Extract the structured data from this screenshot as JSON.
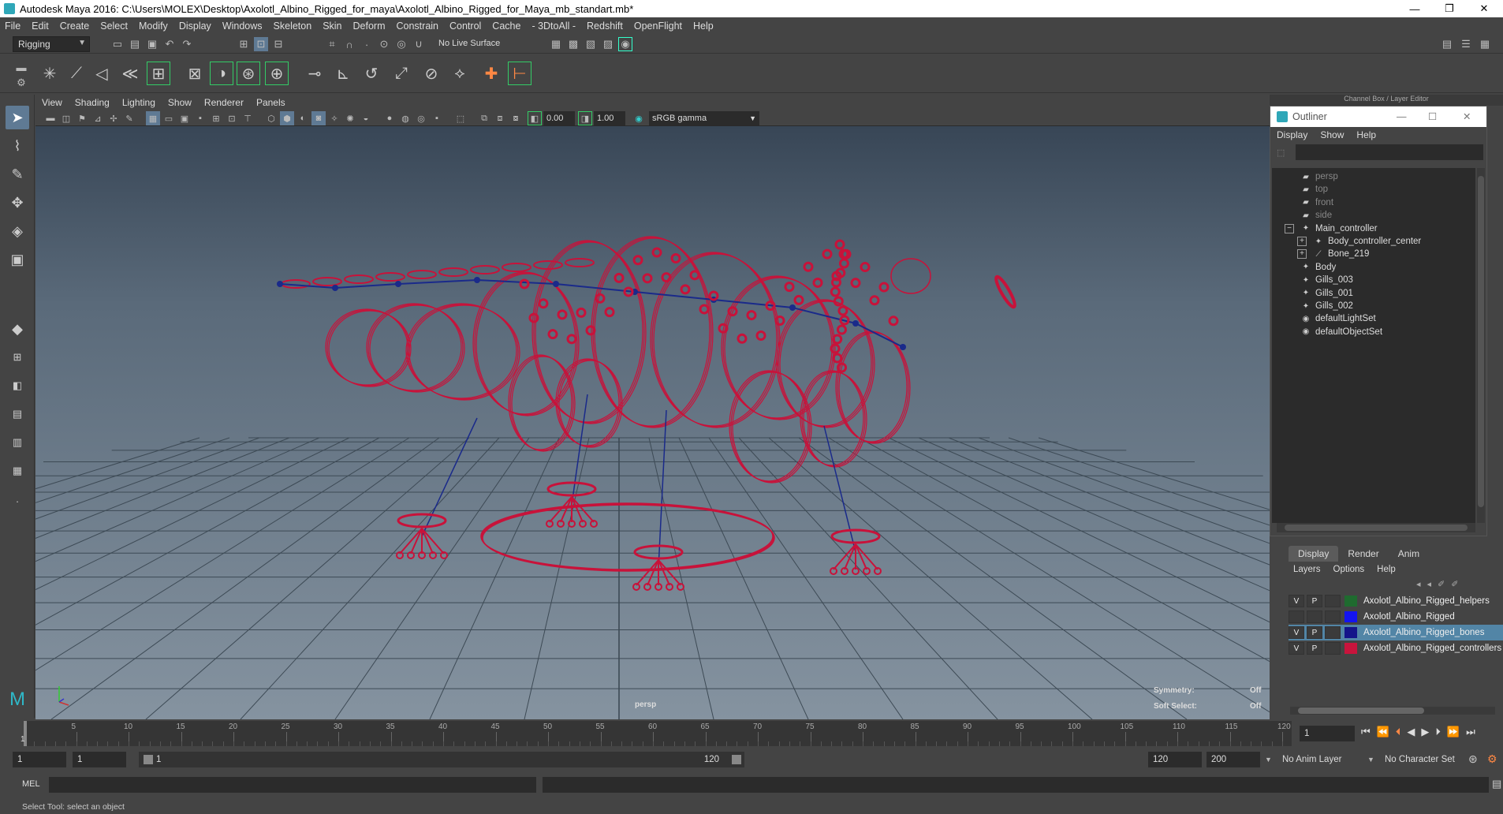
{
  "window": {
    "title": "Autodesk Maya 2016: C:\\Users\\MOLEX\\Desktop\\Axolotl_Albino_Rigged_for_maya\\Axolotl_Albino_Rigged_for_Maya_mb_standart.mb*",
    "minimize": "—",
    "restore": "❐",
    "close": "✕"
  },
  "menubar": [
    "File",
    "Edit",
    "Create",
    "Select",
    "Modify",
    "Display",
    "Windows",
    "Skeleton",
    "Skin",
    "Deform",
    "Constrain",
    "Control",
    "Cache",
    "- 3DtoAll -",
    "Redshift",
    "OpenFlight",
    "Help"
  ],
  "status_line": {
    "mode": "Rigging",
    "live_surface": "No Live Surface"
  },
  "viewport": {
    "menus": [
      "View",
      "Shading",
      "Lighting",
      "Show",
      "Renderer",
      "Panels"
    ],
    "near_value": "0.00",
    "far_value": "1.00",
    "color_space": "sRGB gamma",
    "camera_label": "persp",
    "symmetry_label": "Symmetry:",
    "symmetry_value": "Off",
    "soft_select_label": "Soft Select:",
    "soft_select_value": "Off",
    "wire_color": "#c8123a",
    "bone_color": "#1a2a8a"
  },
  "channel_box_title": "Channel Box / Layer Editor",
  "outliner": {
    "title": "Outliner",
    "menus": [
      "Display",
      "Show",
      "Help"
    ],
    "items": [
      {
        "label": "persp",
        "icon": "camera-icon",
        "indent": 0,
        "dim": true,
        "expand": ""
      },
      {
        "label": "top",
        "icon": "camera-icon",
        "indent": 0,
        "dim": true,
        "expand": ""
      },
      {
        "label": "front",
        "icon": "camera-icon",
        "indent": 0,
        "dim": true,
        "expand": ""
      },
      {
        "label": "side",
        "icon": "camera-icon",
        "indent": 0,
        "dim": true,
        "expand": ""
      },
      {
        "label": "Main_controller",
        "icon": "transform-icon",
        "indent": 0,
        "dim": false,
        "expand": "−"
      },
      {
        "label": "Body_controller_center",
        "icon": "transform-icon",
        "indent": 1,
        "dim": false,
        "expand": "+"
      },
      {
        "label": "Bone_219",
        "icon": "joint-icon",
        "indent": 1,
        "dim": false,
        "expand": "+"
      },
      {
        "label": "Body",
        "icon": "transform-icon",
        "indent": 0,
        "dim": false,
        "expand": ""
      },
      {
        "label": "Gills_003",
        "icon": "transform-icon",
        "indent": 0,
        "dim": false,
        "expand": ""
      },
      {
        "label": "Gills_001",
        "icon": "transform-icon",
        "indent": 0,
        "dim": false,
        "expand": ""
      },
      {
        "label": "Gills_002",
        "icon": "transform-icon",
        "indent": 0,
        "dim": false,
        "expand": ""
      },
      {
        "label": "defaultLightSet",
        "icon": "set-icon",
        "indent": 0,
        "dim": false,
        "expand": ""
      },
      {
        "label": "defaultObjectSet",
        "icon": "set-icon",
        "indent": 0,
        "dim": false,
        "expand": ""
      }
    ]
  },
  "layer_editor": {
    "tabs": [
      "Display",
      "Render",
      "Anim"
    ],
    "menus": [
      "Layers",
      "Options",
      "Help"
    ],
    "layers": [
      {
        "v": "V",
        "p": "P",
        "color": "#1f6b2f",
        "name": "Axolotl_Albino_Rigged_helpers",
        "selected": false
      },
      {
        "v": "",
        "p": "",
        "color": "#1414f0",
        "name": "Axolotl_Albino_Rigged",
        "selected": false
      },
      {
        "v": "V",
        "p": "P",
        "color": "#14148a",
        "name": "Axolotl_Albino_Rigged_bones",
        "selected": true
      },
      {
        "v": "V",
        "p": "P",
        "color": "#c8143c",
        "name": "Axolotl_Albino_Rigged_controllers",
        "selected": false
      }
    ]
  },
  "time_slider": {
    "ticks": [
      "5",
      "10",
      "15",
      "20",
      "25",
      "30",
      "35",
      "40",
      "45",
      "50",
      "55",
      "60",
      "65",
      "70",
      "75",
      "80",
      "85",
      "90",
      "95",
      "100",
      "105",
      "110",
      "115",
      "120"
    ],
    "start_label": "1",
    "current_frame": "1"
  },
  "range_slider": {
    "start": "1",
    "playback_start": "1",
    "range_min": "1",
    "range_max": "120",
    "playback_end": "120",
    "end": "200",
    "anim_layer": "No Anim Layer",
    "character_set": "No Character Set"
  },
  "command_line": {
    "language": "MEL"
  },
  "help_line": "Select Tool: select an object"
}
